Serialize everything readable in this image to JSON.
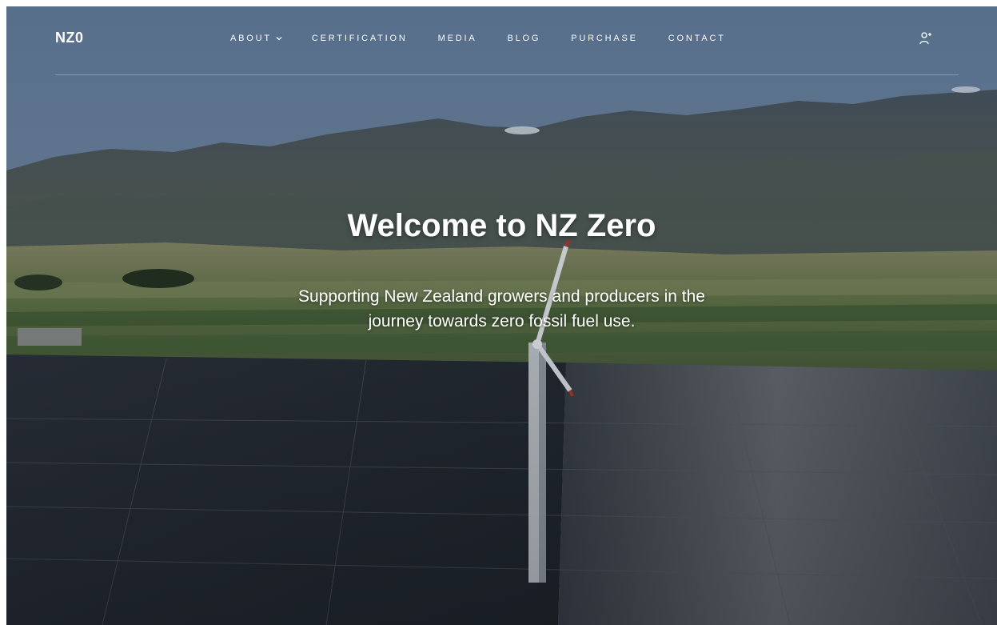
{
  "header": {
    "logo": "NZ0",
    "nav": [
      {
        "label": "ABOUT",
        "has_dropdown": true
      },
      {
        "label": "CERTIFICATION"
      },
      {
        "label": "MEDIA"
      },
      {
        "label": "BLOG"
      },
      {
        "label": "PURCHASE"
      },
      {
        "label": "CONTACT"
      }
    ],
    "account_icon": "user-icon"
  },
  "hero": {
    "title": "Welcome to NZ Zero",
    "subtitle_lines": [
      "Supporting New Zealand growers and producers in the",
      "journey towards zero fossil fuel use."
    ],
    "background": "aerial-solar-farm-wind-turbine-mountains"
  },
  "colors": {
    "text": "#ffffff",
    "sky": "#6f86a3",
    "mountain": "#3c4a55",
    "field": "#6e7d4f",
    "solar": "#2a3038"
  }
}
